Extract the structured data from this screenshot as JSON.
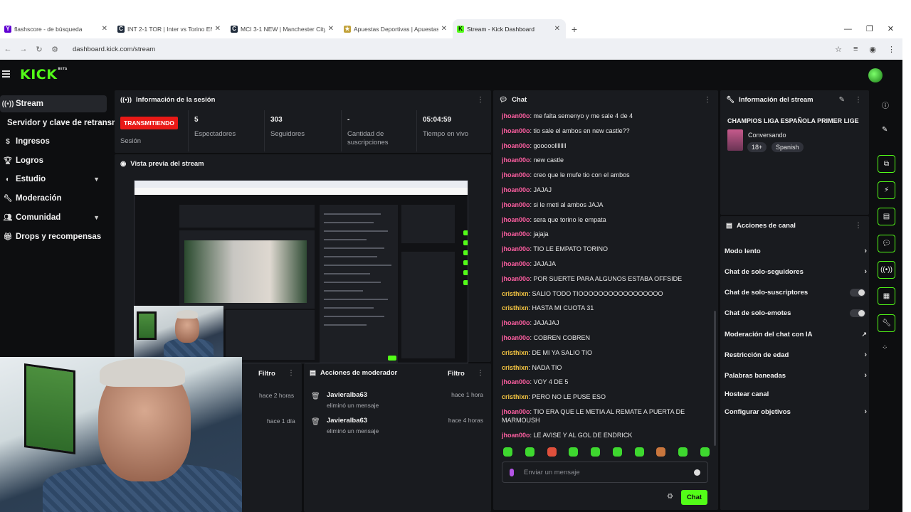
{
  "browser": {
    "tabs": [
      {
        "title": "flashscore - de búsqueda",
        "favicon": "yahoo-icon",
        "color": "#6001d2"
      },
      {
        "title": "INT 2-1 TOR | Inter vs Torino EN",
        "favicon": "c-icon",
        "color": "#1e2a3a"
      },
      {
        "title": "MCI 3-1 NEW | Manchester City",
        "favicon": "c-icon",
        "color": "#1e2a3a"
      },
      {
        "title": "Apuestas Deportivas | Apuestas",
        "favicon": "bet-icon",
        "color": "#c2a23b"
      },
      {
        "title": "Stream - Kick Dashboard",
        "favicon": "kick-icon",
        "color": "#53fc18",
        "active": true
      }
    ],
    "new_tab": "+",
    "url": "dashboard.kick.com/stream"
  },
  "app": {
    "logo": "KICK",
    "logo_sup": "BETA",
    "brand_color": "#53fc18"
  },
  "sidebar": {
    "items": [
      {
        "label": "Stream",
        "icon": "broadcast-icon"
      },
      {
        "label": "Servidor y clave de retransmisión",
        "icon": ""
      },
      {
        "label": "Ingresos",
        "icon": "money-icon"
      },
      {
        "label": "Logros",
        "icon": "trophy-icon"
      },
      {
        "label": "Estudio",
        "icon": "palette-icon"
      },
      {
        "label": "Moderación",
        "icon": "wrench-icon"
      },
      {
        "label": "Comunidad",
        "icon": "people-icon"
      },
      {
        "label": "Drops y recompensas",
        "icon": "gift-icon"
      }
    ]
  },
  "session": {
    "title": "Información de la sesión",
    "live_badge": "TRANSMITIENDO",
    "live_label": "Sesión",
    "stats": [
      {
        "value": "5",
        "label": "Espectadores"
      },
      {
        "value": "303",
        "label": "Seguidores"
      },
      {
        "value": "-",
        "label": "Cantidad de suscripciones"
      },
      {
        "value": "05:04:59",
        "label": "Tiempo en vivo"
      }
    ]
  },
  "preview": {
    "title": "Vista previa del stream"
  },
  "moderators_log": {
    "filter": "Filtro",
    "times": [
      "hace 2 horas",
      "hace 1 día"
    ]
  },
  "mod_actions": {
    "title": "Acciones de moderador",
    "filter": "Filtro",
    "entries": [
      {
        "name": "Javieralba63",
        "action": "eliminó un mensaje",
        "time": "hace 1 hora"
      },
      {
        "name": "Javieralba63",
        "action": "eliminó un mensaje",
        "time": "hace 4 horas"
      }
    ]
  },
  "chat": {
    "title": "Chat",
    "messages": [
      {
        "user": "jhoan00o",
        "text": "me falta semenyo y me sale 4 de 4",
        "color": "#ff5fa2"
      },
      {
        "user": "jhoan00o",
        "text": "tio sale el ambos en new castle??",
        "color": "#ff5fa2"
      },
      {
        "user": "jhoan00o",
        "text": "gooooollllllll",
        "color": "#ff5fa2"
      },
      {
        "user": "jhoan00o",
        "text": "new castle",
        "color": "#ff5fa2"
      },
      {
        "user": "jhoan00o",
        "text": "creo que le mufe tio con el ambos",
        "color": "#ff5fa2"
      },
      {
        "user": "jhoan00o",
        "text": "JAJAJ",
        "color": "#ff5fa2"
      },
      {
        "user": "jhoan00o",
        "text": "si le meti al ambos JAJA",
        "color": "#ff5fa2"
      },
      {
        "user": "jhoan00o",
        "text": "sera que torino le empata",
        "color": "#ff5fa2"
      },
      {
        "user": "jhoan00o",
        "text": "jajaja",
        "color": "#ff5fa2"
      },
      {
        "user": "jhoan00o",
        "text": "TIO LE EMPATO TORINO",
        "color": "#ff5fa2"
      },
      {
        "user": "jhoan00o",
        "text": "JAJAJA",
        "color": "#ff5fa2"
      },
      {
        "user": "jhoan00o",
        "text": "POR SUERTE PARA ALGUNOS ESTABA OFFSIDE",
        "color": "#ff5fa2"
      },
      {
        "user": "cristhixn",
        "text": "SALIO TODO TIOOOOOOOOOOOOOOOOO",
        "color": "#f5c542"
      },
      {
        "user": "cristhixn",
        "text": "HASTA MI CUOTA 31",
        "color": "#f5c542"
      },
      {
        "user": "jhoan00o",
        "text": "JAJAJAJ",
        "color": "#ff5fa2"
      },
      {
        "user": "jhoan00o",
        "text": "COBREN COBREN",
        "color": "#ff5fa2"
      },
      {
        "user": "cristhixn",
        "text": "DE MI YA SALIO TIO",
        "color": "#f5c542"
      },
      {
        "user": "cristhixn",
        "text": "NADA TIO",
        "color": "#f5c542"
      },
      {
        "user": "jhoan00o",
        "text": "VOY 4 DE 5",
        "color": "#ff5fa2"
      },
      {
        "user": "cristhixn",
        "text": "PERO NO LE PUSE ESO",
        "color": "#f5c542"
      },
      {
        "user": "jhoan00o",
        "text": "TIO ERA QUE LE METIA AL REMATE A PUERTA DE MARMOUSH",
        "color": "#ff5fa2"
      },
      {
        "user": "jhoan00o",
        "text": "LE AVISE Y AL GOL DE ENDRICK",
        "color": "#ff5fa2"
      }
    ],
    "input_placeholder": "Enviar un mensaje",
    "send_label": "Chat"
  },
  "stream_info": {
    "title": "Información del stream",
    "stream_title": "CHAMPIOS LIGA ESPAÑOLA PRIMER LIGE",
    "category": "Conversando",
    "tags": [
      "18+",
      "Spanish"
    ]
  },
  "channel_actions": {
    "title": "Acciones de canal",
    "items": [
      {
        "label": "Modo lento",
        "control": "chevron"
      },
      {
        "label": "Chat de solo-seguidores",
        "control": "chevron"
      },
      {
        "label": "Chat de solo-suscriptores",
        "control": "toggle"
      },
      {
        "label": "Chat de solo-emotes",
        "control": "toggle"
      },
      {
        "label": "Moderación del chat con IA",
        "control": "external"
      },
      {
        "label": "Restricción de edad",
        "control": "chevron"
      },
      {
        "label": "Palabras baneadas",
        "control": "chevron"
      },
      {
        "label": "Hostear canal",
        "control": "none"
      },
      {
        "label": "Configurar objetivos",
        "control": "chevron"
      }
    ]
  }
}
